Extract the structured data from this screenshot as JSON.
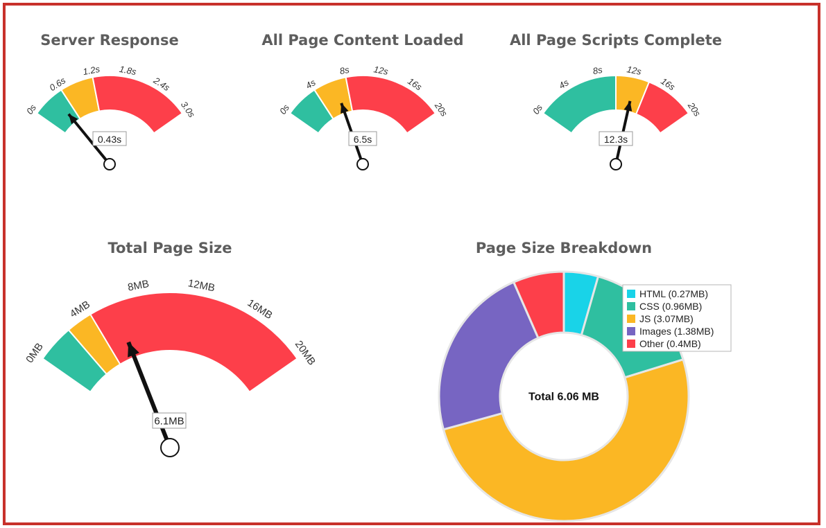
{
  "colors": {
    "green": "#2fbfa0",
    "yellow": "#fbb724",
    "red": "#fd3f4a",
    "cyan": "#19d3e8",
    "teal": "#2fbfa0",
    "purple": "#7765c2",
    "frame": "#c8312b"
  },
  "chart_data": [
    {
      "type": "gauge",
      "title": "Server Response",
      "min": 0,
      "max": 3.0,
      "ticks": [
        "0s",
        "0.6s",
        "1.2s",
        "1.8s",
        "2.4s",
        "3.0s"
      ],
      "tick_values": [
        0,
        0.6,
        1.2,
        1.8,
        2.4,
        3.0
      ],
      "bands": [
        {
          "from": 0,
          "to": 0.6,
          "color": "green"
        },
        {
          "from": 0.6,
          "to": 1.2,
          "color": "yellow"
        },
        {
          "from": 1.2,
          "to": 3.0,
          "color": "red"
        }
      ],
      "value": 0.43,
      "value_label": "0.43s"
    },
    {
      "type": "gauge",
      "title": "All Page Content Loaded",
      "min": 0,
      "max": 20,
      "ticks": [
        "0s",
        "4s",
        "8s",
        "12s",
        "16s",
        "20s"
      ],
      "tick_values": [
        0,
        4,
        8,
        12,
        16,
        20
      ],
      "bands": [
        {
          "from": 0,
          "to": 4,
          "color": "green"
        },
        {
          "from": 4,
          "to": 8,
          "color": "yellow"
        },
        {
          "from": 8,
          "to": 20,
          "color": "red"
        }
      ],
      "value": 6.5,
      "value_label": "6.5s"
    },
    {
      "type": "gauge",
      "title": "All Page Scripts Complete",
      "min": 0,
      "max": 20,
      "ticks": [
        "0s",
        "4s",
        "8s",
        "12s",
        "16s",
        "20s"
      ],
      "tick_values": [
        0,
        4,
        8,
        12,
        16,
        20
      ],
      "bands": [
        {
          "from": 0,
          "to": 10,
          "color": "green"
        },
        {
          "from": 10,
          "to": 14,
          "color": "yellow"
        },
        {
          "from": 14,
          "to": 20,
          "color": "red"
        }
      ],
      "value": 12.3,
      "value_label": "12.3s"
    },
    {
      "type": "gauge",
      "title": "Total Page Size",
      "min": 0,
      "max": 20,
      "ticks": [
        "0MB",
        "4MB",
        "8MB",
        "12MB",
        "16MB",
        "20MB"
      ],
      "tick_values": [
        0,
        4,
        8,
        12,
        16,
        20
      ],
      "bands": [
        {
          "from": 0,
          "to": 2.6,
          "color": "green"
        },
        {
          "from": 2.6,
          "to": 4.4,
          "color": "yellow"
        },
        {
          "from": 4.4,
          "to": 20,
          "color": "red"
        }
      ],
      "value": 6.1,
      "value_label": "6.1MB"
    },
    {
      "type": "pie",
      "title": "Page Size Breakdown",
      "center_label": "Total 6.06 MB",
      "slices": [
        {
          "name": "HTML (0.27MB)",
          "value": 0.27,
          "color": "cyan"
        },
        {
          "name": "CSS (0.96MB)",
          "value": 0.96,
          "color": "teal"
        },
        {
          "name": "JS (3.07MB)",
          "value": 3.07,
          "color": "yellow"
        },
        {
          "name": "Images (1.38MB)",
          "value": 1.38,
          "color": "purple"
        },
        {
          "name": "Other (0.4MB)",
          "value": 0.4,
          "color": "red"
        }
      ]
    }
  ]
}
